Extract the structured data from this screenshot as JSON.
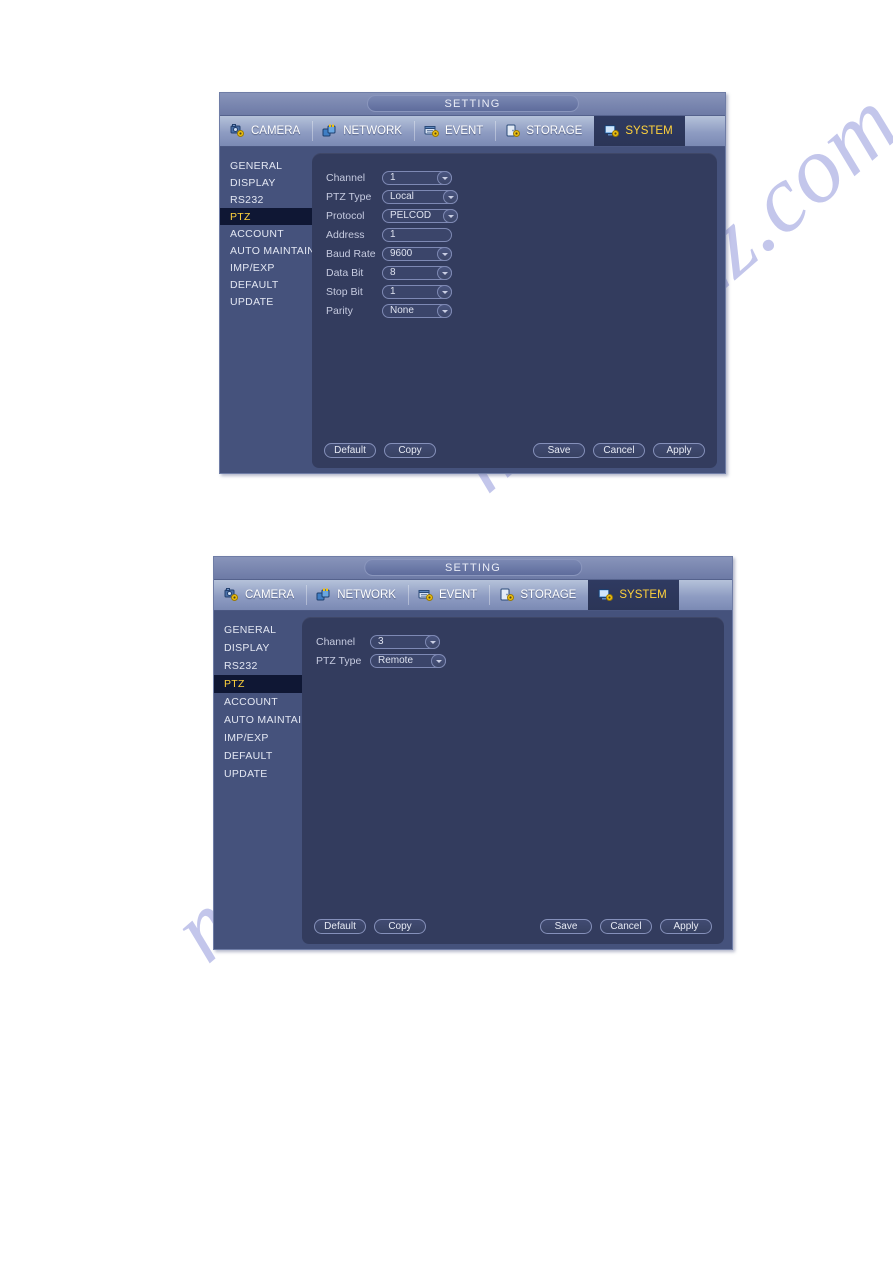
{
  "watermark": {
    "line1": "manualzz.com",
    "line2": "manualzz.com"
  },
  "panels": [
    {
      "title": "SETTING",
      "tabs": [
        {
          "label": "CAMERA",
          "icon": "camera-gear-icon",
          "active": false
        },
        {
          "label": "NETWORK",
          "icon": "network-icon",
          "active": false
        },
        {
          "label": "EVENT",
          "icon": "event-gear-icon",
          "active": false
        },
        {
          "label": "STORAGE",
          "icon": "storage-gear-icon",
          "active": false
        },
        {
          "label": "SYSTEM",
          "icon": "system-gear-icon",
          "active": true
        }
      ],
      "menu": [
        {
          "label": "GENERAL",
          "selected": false
        },
        {
          "label": "DISPLAY",
          "selected": false
        },
        {
          "label": "RS232",
          "selected": false
        },
        {
          "label": "PTZ",
          "selected": true
        },
        {
          "label": "ACCOUNT",
          "selected": false
        },
        {
          "label": "AUTO MAINTAIN",
          "selected": false
        },
        {
          "label": "IMP/EXP",
          "selected": false
        },
        {
          "label": "DEFAULT",
          "selected": false
        },
        {
          "label": "UPDATE",
          "selected": false
        }
      ],
      "fields": [
        {
          "label": "Channel",
          "value": "1",
          "type": "select"
        },
        {
          "label": "PTZ Type",
          "value": "Local",
          "type": "select"
        },
        {
          "label": "Protocol",
          "value": "PELCOD",
          "type": "select"
        },
        {
          "label": "Address",
          "value": "1",
          "type": "text"
        },
        {
          "label": "Baud Rate",
          "value": "9600",
          "type": "select"
        },
        {
          "label": "Data Bit",
          "value": "8",
          "type": "select"
        },
        {
          "label": "Stop Bit",
          "value": "1",
          "type": "select"
        },
        {
          "label": "Parity",
          "value": "None",
          "type": "select"
        }
      ],
      "buttons_left": [
        "Default",
        "Copy"
      ],
      "buttons_right": [
        "Save",
        "Cancel",
        "Apply"
      ]
    },
    {
      "title": "SETTING",
      "tabs": [
        {
          "label": "CAMERA",
          "icon": "camera-gear-icon",
          "active": false
        },
        {
          "label": "NETWORK",
          "icon": "network-icon",
          "active": false
        },
        {
          "label": "EVENT",
          "icon": "event-gear-icon",
          "active": false
        },
        {
          "label": "STORAGE",
          "icon": "storage-gear-icon",
          "active": false
        },
        {
          "label": "SYSTEM",
          "icon": "system-gear-icon",
          "active": true
        }
      ],
      "menu": [
        {
          "label": "GENERAL",
          "selected": false
        },
        {
          "label": "DISPLAY",
          "selected": false
        },
        {
          "label": "RS232",
          "selected": false
        },
        {
          "label": "PTZ",
          "selected": true
        },
        {
          "label": "ACCOUNT",
          "selected": false
        },
        {
          "label": "AUTO MAINTAIN",
          "selected": false
        },
        {
          "label": "IMP/EXP",
          "selected": false
        },
        {
          "label": "DEFAULT",
          "selected": false
        },
        {
          "label": "UPDATE",
          "selected": false
        }
      ],
      "fields": [
        {
          "label": "Channel",
          "value": "3",
          "type": "select"
        },
        {
          "label": "PTZ Type",
          "value": "Remote",
          "type": "select"
        }
      ],
      "buttons_left": [
        "Default",
        "Copy"
      ],
      "buttons_right": [
        "Save",
        "Cancel",
        "Apply"
      ]
    }
  ]
}
